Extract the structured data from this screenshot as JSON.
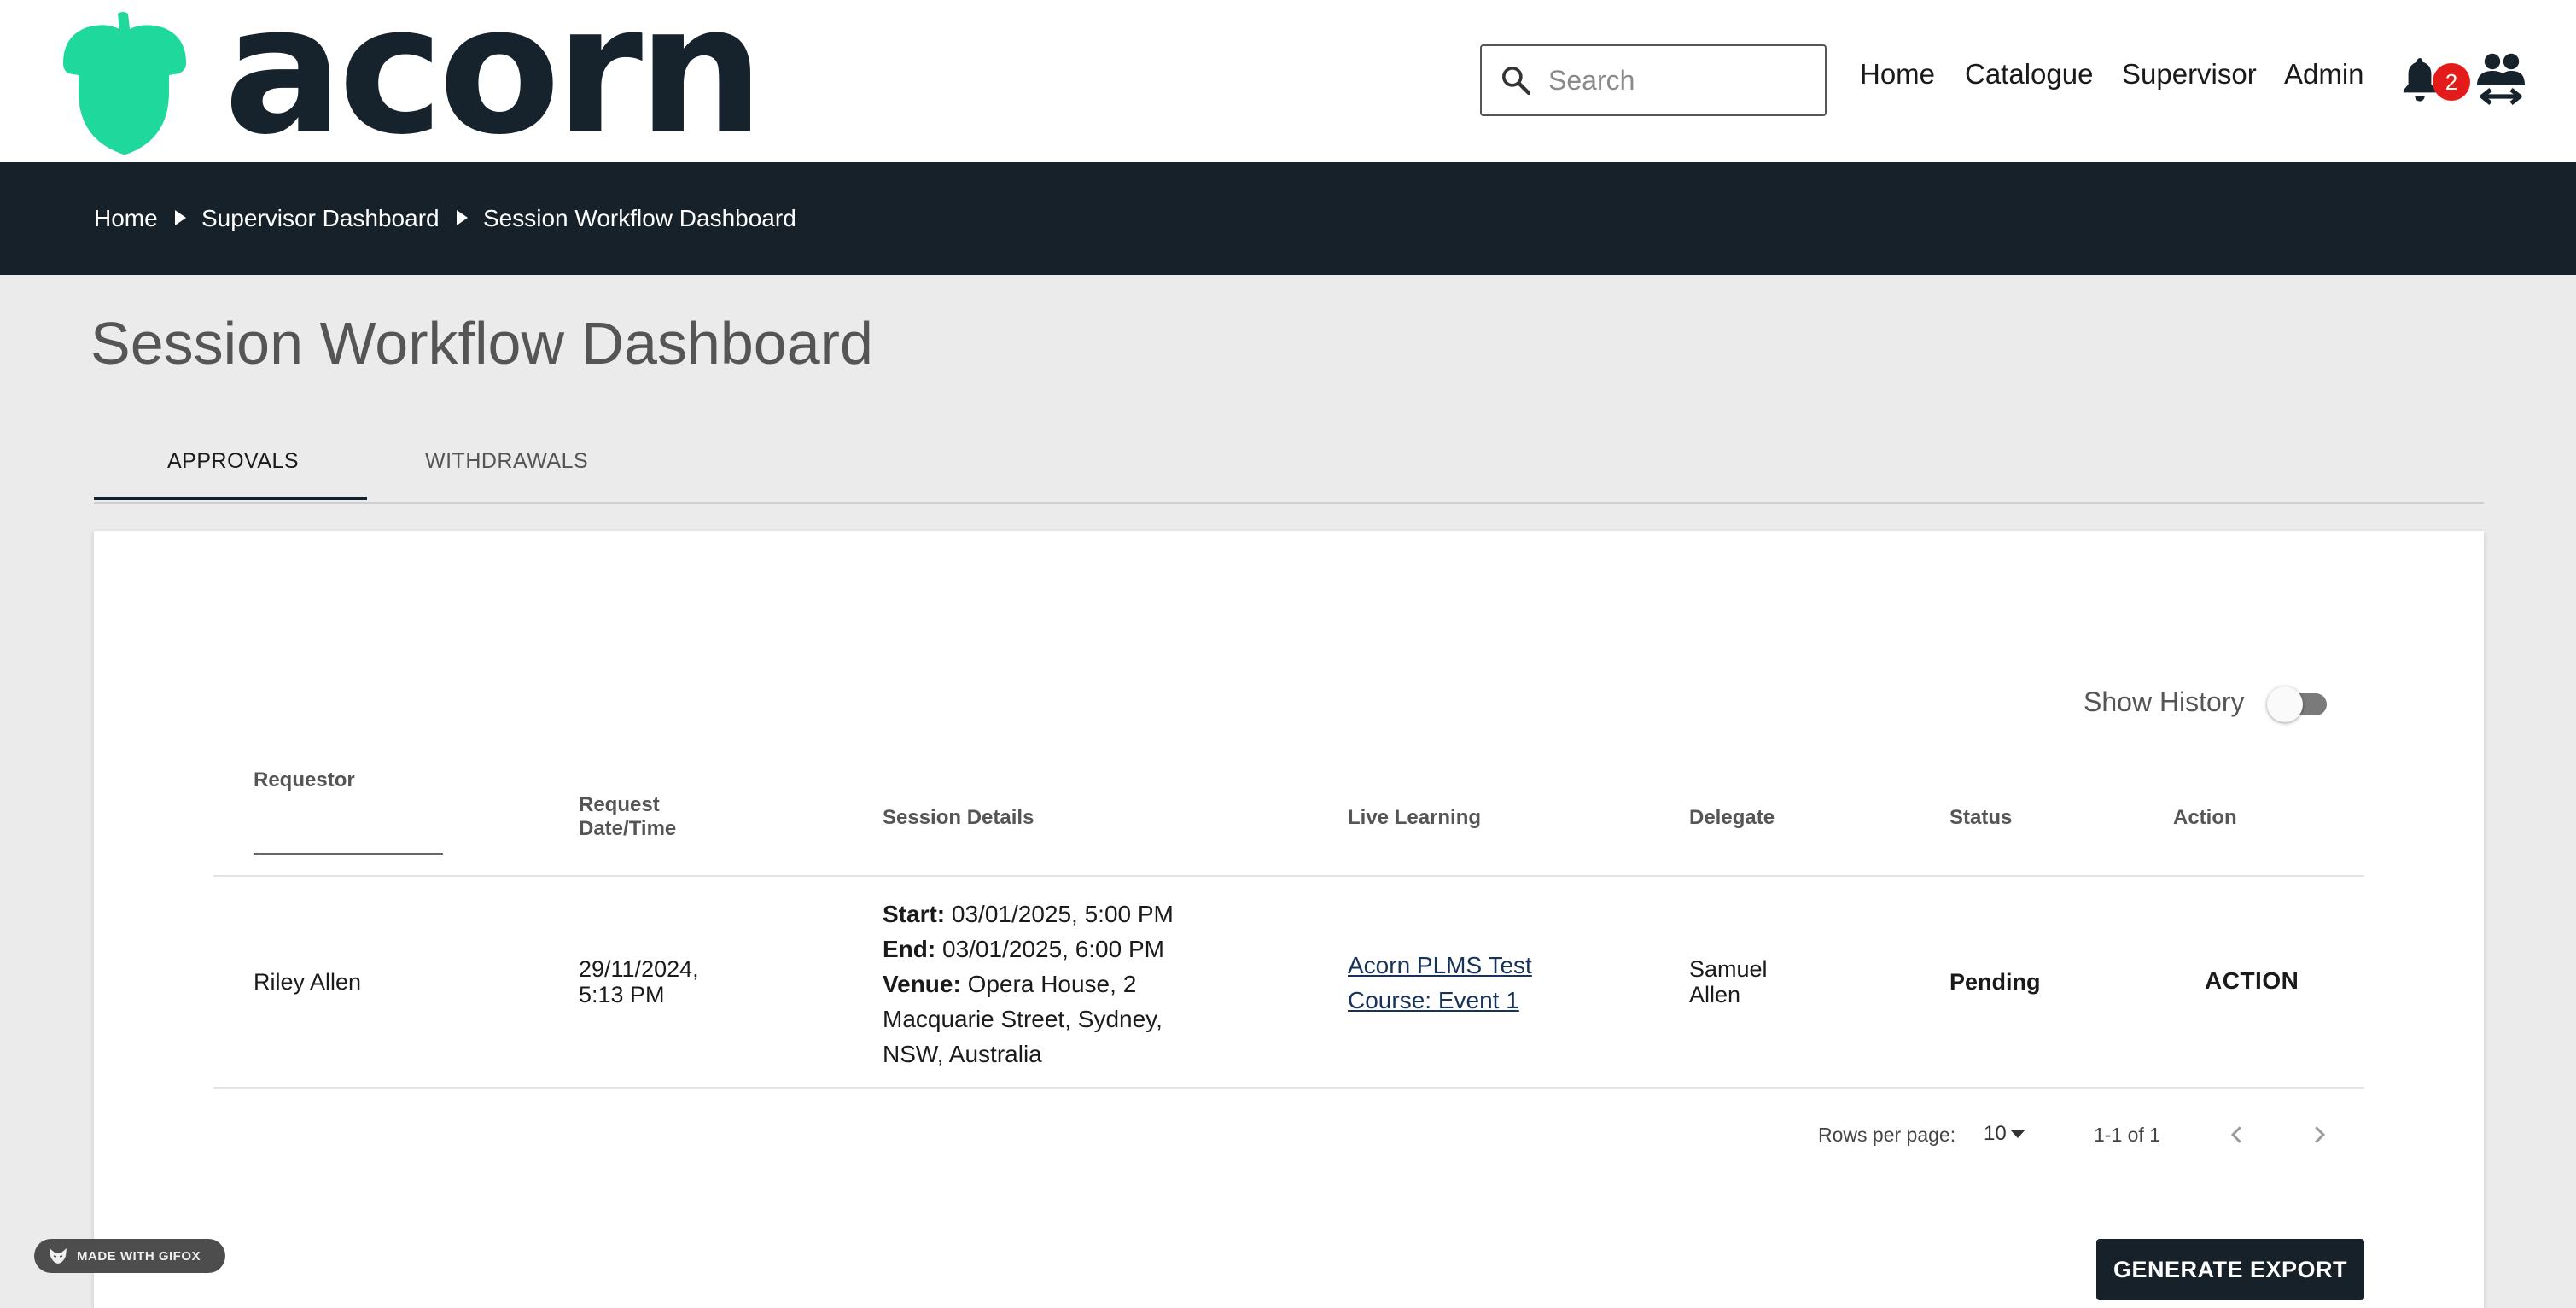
{
  "header": {
    "logo_text": "acorn",
    "search": {
      "placeholder": "Search",
      "value": ""
    },
    "nav": [
      "Home",
      "Catalogue",
      "Supervisor",
      "Admin"
    ],
    "notification_count": "2"
  },
  "breadcrumb": [
    "Home",
    "Supervisor Dashboard",
    "Session Workflow Dashboard"
  ],
  "page": {
    "title": "Session Workflow Dashboard",
    "tabs": [
      {
        "label": "APPROVALS",
        "active": true
      },
      {
        "label": "WITHDRAWALS",
        "active": false
      }
    ]
  },
  "table": {
    "show_history_label": "Show History",
    "show_history_on": false,
    "columns": {
      "requestor": "Requestor",
      "request_datetime": [
        "Request",
        "Date/Time"
      ],
      "session_details": "Session Details",
      "live_learning": "Live Learning",
      "delegate": "Delegate",
      "status": "Status",
      "action": "Action"
    },
    "rows": [
      {
        "requestor": "Riley Allen",
        "request_datetime": [
          "29/11/2024,",
          "5:13 PM"
        ],
        "session": {
          "start_label": "Start:",
          "start": " 03/01/2025, 5:00 PM",
          "end_label": "End:",
          "end": " 03/01/2025, 6:00 PM",
          "venue_label": "Venue:",
          "venue": " Opera House, 2 Macquarie Street, Sydney, NSW, Australia"
        },
        "live_learning": "Acorn PLMS Test Course: Event 1",
        "delegate": [
          "Samuel",
          "Allen"
        ],
        "status": "Pending",
        "action": "ACTION"
      }
    ],
    "pagination": {
      "rows_per_page_label": "Rows per page:",
      "rows_per_page": "10",
      "range": "1-1 of 1"
    },
    "export_label": "GENERATE EXPORT"
  },
  "watermark": "MADE WITH GIFOX",
  "colors": {
    "brand_green": "#1fd89c",
    "dark_navy": "#17212a",
    "badge_red": "#e31b1b",
    "link_blue": "#17335a"
  }
}
